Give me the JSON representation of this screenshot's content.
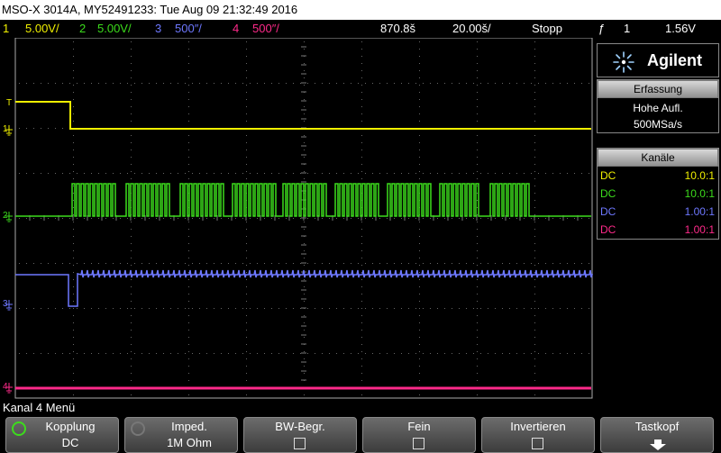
{
  "titlebar": {
    "text": "MSO-X 3014A, MY52491233: Tue Aug 09 21:32:49 2016"
  },
  "channel_bar": {
    "ch1": {
      "num": "1",
      "scale": "5.00V/",
      "color": "#f0f000"
    },
    "ch2": {
      "num": "2",
      "scale": "5.00V/",
      "color": "#3cdc1c"
    },
    "ch3": {
      "num": "3",
      "scale": "500″/",
      "color": "#6e78ff"
    },
    "ch4": {
      "num": "4",
      "scale": "500″/",
      "color": "#ff2a8a"
    },
    "delay": "870.8š",
    "timebase": "20.00š/",
    "run_state": "Stopp",
    "trigger_slope_icon": "ƒ",
    "trigger_source": "1",
    "trigger_level": "1.56V"
  },
  "brand": {
    "logo_icon": "agilent-spark-icon",
    "name": "Agilent"
  },
  "acquisition": {
    "header": "Erfassung",
    "mode": "Hohe Aufl.",
    "rate": "500MSa/s"
  },
  "channels_panel": {
    "header": "Kanäle",
    "rows": [
      {
        "coupling": "DC",
        "probe": "10.0:1",
        "color": "#f0f000"
      },
      {
        "coupling": "DC",
        "probe": "10.0:1",
        "color": "#3cdc1c"
      },
      {
        "coupling": "DC",
        "probe": "1.00:1",
        "color": "#6e78ff"
      },
      {
        "coupling": "DC",
        "probe": "1.00:1",
        "color": "#ff2a8a"
      }
    ]
  },
  "markers": {
    "trigger": "T",
    "ch1": "1",
    "ch2": "2",
    "ch3": "3",
    "ch4": "4"
  },
  "menu": {
    "title": "Kanal 4 Menü"
  },
  "softkeys": {
    "coupling": {
      "label": "Kopplung",
      "value": "DC"
    },
    "impedance": {
      "label": "Imped.",
      "value": "1M Ohm"
    },
    "bw_limit": {
      "label": "BW-Begr.",
      "checked": false
    },
    "fine": {
      "label": "Fein",
      "checked": false
    },
    "invert": {
      "label": "Invertieren",
      "checked": false
    },
    "probe": {
      "label": "Tastkopf"
    }
  }
}
